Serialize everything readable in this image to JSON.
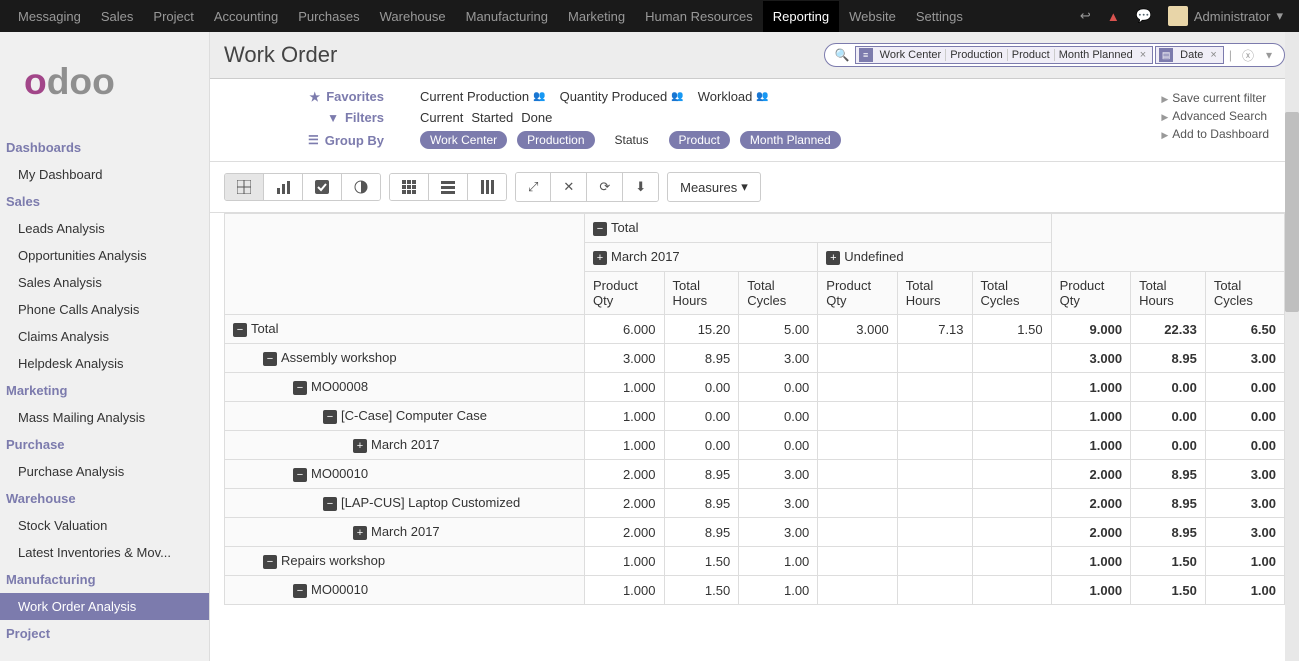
{
  "topbar": {
    "menus": [
      "Messaging",
      "Sales",
      "Project",
      "Accounting",
      "Purchases",
      "Warehouse",
      "Manufacturing",
      "Marketing",
      "Human Resources",
      "Reporting",
      "Website",
      "Settings"
    ],
    "active": "Reporting",
    "user": "Administrator"
  },
  "sidebar": {
    "logo": "odoo",
    "sections": [
      {
        "title": "Dashboards",
        "items": [
          "My Dashboard"
        ]
      },
      {
        "title": "Sales",
        "items": [
          "Leads Analysis",
          "Opportunities Analysis",
          "Sales Analysis",
          "Phone Calls Analysis",
          "Claims Analysis",
          "Helpdesk Analysis"
        ]
      },
      {
        "title": "Marketing",
        "items": [
          "Mass Mailing Analysis"
        ]
      },
      {
        "title": "Purchase",
        "items": [
          "Purchase Analysis"
        ]
      },
      {
        "title": "Warehouse",
        "items": [
          "Stock Valuation",
          "Latest Inventories & Mov..."
        ]
      },
      {
        "title": "Manufacturing",
        "items": [
          "Work Order Analysis"
        ]
      },
      {
        "title": "Project",
        "items": []
      }
    ],
    "active_item": "Work Order Analysis"
  },
  "header": {
    "title": "Work Order",
    "search": {
      "group_facets": [
        "Work Center",
        "Production",
        "Product",
        "Month Planned"
      ],
      "filter_facets": [
        "Date"
      ]
    }
  },
  "controls": {
    "favorites": {
      "label": "Favorites",
      "items": [
        "Current Production",
        "Quantity Produced",
        "Workload"
      ]
    },
    "filters": {
      "label": "Filters",
      "items": [
        "Current",
        "Started",
        "Done"
      ]
    },
    "groupby": {
      "label": "Group By",
      "items": [
        {
          "text": "Work Center",
          "on": true
        },
        {
          "text": "Production",
          "on": true
        },
        {
          "text": "Status",
          "on": false
        },
        {
          "text": "Product",
          "on": true
        },
        {
          "text": "Month Planned",
          "on": true
        }
      ]
    },
    "actions": [
      "Save current filter",
      "Advanced Search",
      "Add to Dashboard"
    ],
    "measures_label": "Measures"
  },
  "pivot": {
    "col_top": {
      "total": "Total",
      "groups": [
        {
          "label": "March 2017",
          "expand": "plus"
        },
        {
          "label": "Undefined",
          "expand": "plus"
        }
      ]
    },
    "metrics": [
      "Product Qty",
      "Total Hours",
      "Total Cycles"
    ],
    "rows": [
      {
        "label": "Total",
        "ind": 0,
        "exp": "minus",
        "march": [
          "6.000",
          "15.20",
          "5.00"
        ],
        "undef": [
          "3.000",
          "7.13",
          "1.50"
        ],
        "tot": [
          "9.000",
          "22.33",
          "6.50"
        ]
      },
      {
        "label": "Assembly workshop",
        "ind": 1,
        "exp": "minus",
        "march": [
          "3.000",
          "8.95",
          "3.00"
        ],
        "undef": [
          "",
          "",
          ""
        ],
        "tot": [
          "3.000",
          "8.95",
          "3.00"
        ]
      },
      {
        "label": "MO00008",
        "ind": 2,
        "exp": "minus",
        "march": [
          "1.000",
          "0.00",
          "0.00"
        ],
        "undef": [
          "",
          "",
          ""
        ],
        "tot": [
          "1.000",
          "0.00",
          "0.00"
        ]
      },
      {
        "label": "[C-Case] Computer Case",
        "ind": 3,
        "exp": "minus",
        "march": [
          "1.000",
          "0.00",
          "0.00"
        ],
        "undef": [
          "",
          "",
          ""
        ],
        "tot": [
          "1.000",
          "0.00",
          "0.00"
        ]
      },
      {
        "label": "March 2017",
        "ind": 4,
        "exp": "plus",
        "march": [
          "1.000",
          "0.00",
          "0.00"
        ],
        "undef": [
          "",
          "",
          ""
        ],
        "tot": [
          "1.000",
          "0.00",
          "0.00"
        ]
      },
      {
        "label": "MO00010",
        "ind": 2,
        "exp": "minus",
        "march": [
          "2.000",
          "8.95",
          "3.00"
        ],
        "undef": [
          "",
          "",
          ""
        ],
        "tot": [
          "2.000",
          "8.95",
          "3.00"
        ]
      },
      {
        "label": "[LAP-CUS] Laptop Customized",
        "ind": 3,
        "exp": "minus",
        "march": [
          "2.000",
          "8.95",
          "3.00"
        ],
        "undef": [
          "",
          "",
          ""
        ],
        "tot": [
          "2.000",
          "8.95",
          "3.00"
        ]
      },
      {
        "label": "March 2017",
        "ind": 4,
        "exp": "plus",
        "march": [
          "2.000",
          "8.95",
          "3.00"
        ],
        "undef": [
          "",
          "",
          ""
        ],
        "tot": [
          "2.000",
          "8.95",
          "3.00"
        ]
      },
      {
        "label": "Repairs workshop",
        "ind": 1,
        "exp": "minus",
        "march": [
          "1.000",
          "1.50",
          "1.00"
        ],
        "undef": [
          "",
          "",
          ""
        ],
        "tot": [
          "1.000",
          "1.50",
          "1.00"
        ]
      },
      {
        "label": "MO00010",
        "ind": 2,
        "exp": "minus",
        "march": [
          "1.000",
          "1.50",
          "1.00"
        ],
        "undef": [
          "",
          "",
          ""
        ],
        "tot": [
          "1.000",
          "1.50",
          "1.00"
        ]
      }
    ]
  }
}
